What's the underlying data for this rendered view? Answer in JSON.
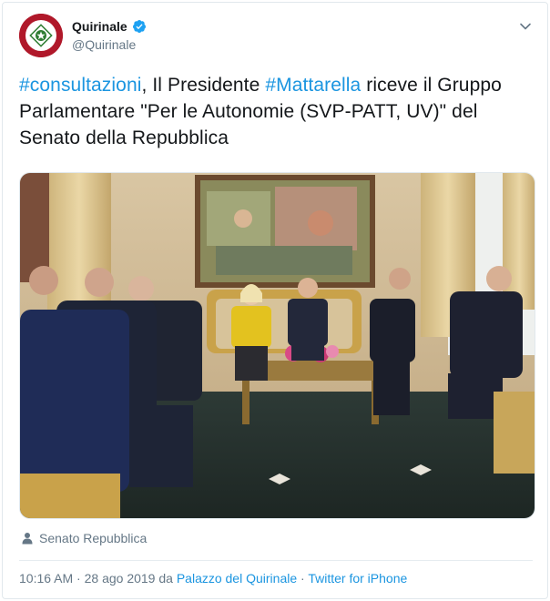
{
  "account": {
    "display_name": "Quirinale",
    "handle": "@Quirinale",
    "verified_icon": "verified-badge-icon",
    "avatar_icon": "quirinale-emblem-icon"
  },
  "tweet": {
    "hashtag_1": "#consultazioni",
    "text_1": ", Il Presidente ",
    "hashtag_2": "#Mattarella",
    "text_2": " riceve il Gruppo Parlamentare \"Per le Autonomie (SVP-PATT, UV)\" del Senato della Repubblica"
  },
  "photo": {
    "icon": "meeting-photo"
  },
  "tagged": {
    "icon": "person-icon",
    "label": "Senato Repubblica"
  },
  "meta": {
    "time": "10:16 AM",
    "sep1": " · ",
    "date": "28 ago 2019",
    "da": " da ",
    "place": "Palazzo del Quirinale",
    "sep2": " · ",
    "source": "Twitter for iPhone"
  },
  "colors": {
    "link": "#1b95e0",
    "secondary": "#657786",
    "avatar_red": "#b0182a"
  }
}
